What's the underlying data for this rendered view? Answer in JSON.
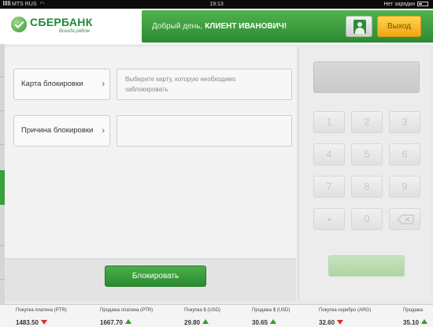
{
  "status_bar": {
    "carrier": "MTS RUS",
    "time": "19:13",
    "charging": "Нет зарядки"
  },
  "header": {
    "logo_name": "СБЕРБАНК",
    "logo_tagline": "Всегда рядом",
    "greeting_prefix": "Добрый день,",
    "client_name": "КЛИЕНТ ИВАНОВИЧ!",
    "logout_label": "Выход",
    "accent_color": "#3a9e3e"
  },
  "form": {
    "card_field_label": "Карта блокировки",
    "card_field_placeholder_line1": "Выберите карту, которую необходимо",
    "card_field_placeholder_line2": "заблокировать",
    "reason_field_label": "Причина блокировки",
    "reason_field_value": "",
    "submit_label": "Блокировать"
  },
  "keypad": {
    "keys": [
      "1",
      "2",
      "3",
      "4",
      "5",
      "6",
      "7",
      "8",
      "9",
      "",
      "0",
      "backspace"
    ]
  },
  "ticker": [
    {
      "label": "Покупка платина (PTR)",
      "value": "1483.50",
      "trend": "down"
    },
    {
      "label": "Продажа платина (PTR)",
      "value": "1667.70",
      "trend": "up"
    },
    {
      "label": "Покупка $ (USD)",
      "value": "29.80",
      "trend": "up"
    },
    {
      "label": "Продажа $ (USD)",
      "value": "30.65",
      "trend": "up"
    },
    {
      "label": "Покупка серебро (ARG)",
      "value": "32.60",
      "trend": "down"
    },
    {
      "label": "Продажа",
      "value": "35.10",
      "trend": "up"
    }
  ]
}
